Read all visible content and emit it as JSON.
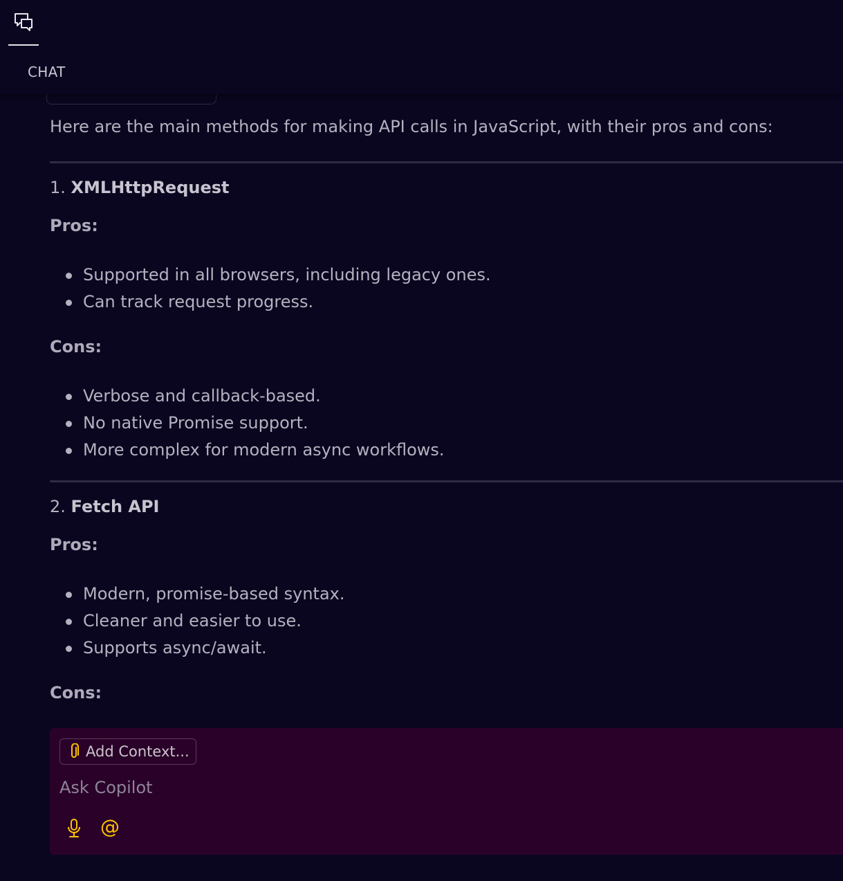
{
  "header": {
    "tab_icon": "chat-icon",
    "title": "CHAT"
  },
  "message": {
    "intro": "Here are the main methods for making API calls in JavaScript, with their pros and cons:",
    "sections": [
      {
        "number": "1.",
        "name": "XMLHttpRequest",
        "pros_label": "Pros:",
        "pros": [
          "Supported in all browsers, including legacy ones.",
          "Can track request progress."
        ],
        "cons_label": "Cons:",
        "cons": [
          "Verbose and callback-based.",
          "No native Promise support.",
          "More complex for modern async workflows."
        ]
      },
      {
        "number": "2.",
        "name": "Fetch API",
        "pros_label": "Pros:",
        "pros": [
          "Modern, promise-based syntax.",
          "Cleaner and easier to use.",
          "Supports async/await."
        ],
        "cons_label": "Cons:"
      }
    ]
  },
  "input": {
    "add_context_label": "Add Context...",
    "add_context_icon": "paperclip-icon",
    "placeholder": "Ask Copilot",
    "mic_icon": "microphone-icon",
    "mention_symbol": "@"
  },
  "colors": {
    "background": "#0b0620",
    "input_panel": "#2a0229",
    "accent": "#ffc400"
  }
}
